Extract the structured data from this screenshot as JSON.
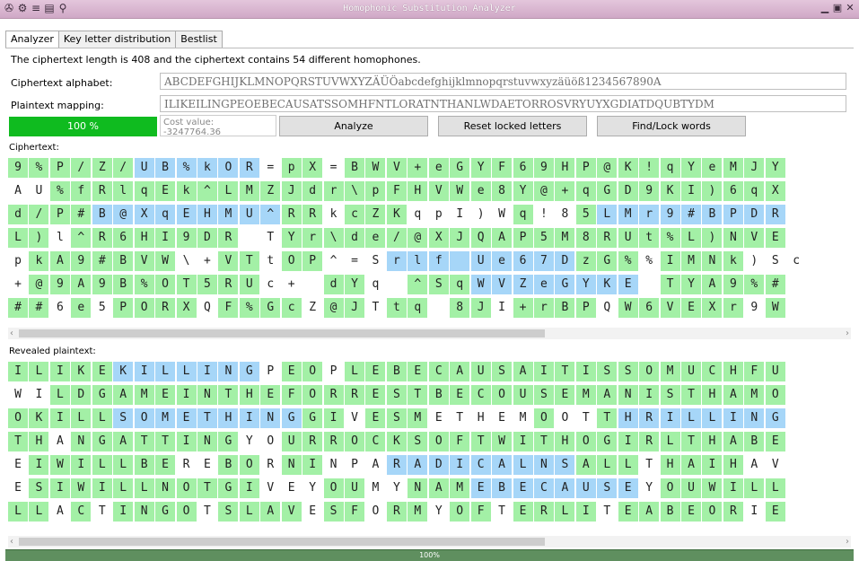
{
  "window": {
    "title": "Homophonic Substitution Analyzer"
  },
  "titlebar_icons": [
    "cipher-app-icon",
    "settings-gear-icon",
    "menu-icon",
    "document-icon",
    "magnifier-icon"
  ],
  "tabs": [
    {
      "label": "Analyzer",
      "active": true
    },
    {
      "label": "Key letter distribution",
      "active": false
    },
    {
      "label": "Bestlist",
      "active": false
    }
  ],
  "info_text": "The ciphertext length is 408 and the ciphertext contains 54 different homophones.",
  "ciphertext_alphabet": {
    "label": "Ciphertext alphabet:",
    "value": "ABCDEFGHIJKLMNOPQRSTUVWXYZÄÜÖabcdefghijklmnopqrstuvwxyzäüöß1234567890A"
  },
  "plaintext_mapping": {
    "label": "Plaintext mapping:",
    "value": "ILIKEILINGPEOEBECAUSATSSOMHFNTLORATNTHANLWDAETORROSVRYUYXGDIATDQUBTYDM"
  },
  "progress": {
    "label": "100 %",
    "value": 1.0
  },
  "cost": {
    "label": "Cost value: -3247764.36"
  },
  "buttons": {
    "analyze": "Analyze",
    "reset": "Reset locked letters",
    "find": "Find/Lock words"
  },
  "sections": {
    "ciphertext": "Ciphertext:",
    "plaintext": "Revealed plaintext:"
  },
  "colors": {
    "green": "#a3f0a6",
    "blue": "#a6d6f8",
    "progress": "#0fbb1f"
  },
  "ciphertext_rows": [
    {
      "chars": "9%P/Z/UB%kOR=pX=BWV+eGYF69HP@K!qYeMJY",
      "colors": "ggggggbbbbbb gg gggggggggggggggggggggg"
    },
    {
      "chars": "AU%fRlqEk^LMZJdr\\pFHVWe8Y@+qGD9KI)6qX",
      "colors": "  ggggggggggggggggggggggggggggggggggg"
    },
    {
      "chars": "d/P#B@XqEHMU^RRkcZKqpI)Wq!85LMr9#BPDR",
      "colors": "ggggbbbbbbbbbgg ggg     g  gbbbbbbbbbg"
    },
    {
      "chars": "L)l^R6HI9DR TYr\\de/@XJQAP5M8RUt%L)NVE",
      "colors": "gg gggggggg  gggggggggggggggggggggggg"
    },
    {
      "chars": "pkA9#BVW\\+VTtOP^=Srlf Ue67DzG%%IMNk)Sc",
      "colors": " ggggggg  gg gg   bbbbbbbbbggg gggg  "
    },
    {
      "chars": "+@9A9B%OT5RUc+ dYq ^SqWVZeGYKE TYA9%#",
      "colors": " ggggggggggg   gg  gggbbbbbbbb gggggg"
    },
    {
      "chars": "##6e5PORXQF%GcZ@JTtq 8JI+rBPQW6VEXr9W",
      "colors": "gg g gggg gggg gg gg gg gggg gggggg g"
    }
  ],
  "plaintext_rows": [
    {
      "chars": "ILIKEKILLINGPEOPLEBECAUSAITISSOMUCHFU",
      "colors": "gggggbbbbbbb gg gggggggggggggggggggggg"
    },
    {
      "chars": "WILDGAMEINTHEFORRESTBECOUSEMANISTHAMO",
      "colors": "  ggggggggggggggggggggggggggggggggggg"
    },
    {
      "chars": "OKILLSOMETHINGGIVESMETHEMOOTTHRILLING",
      "colors": "gggggbbbbbbbbbgg ggg     g  gbbbbbbbbbg"
    },
    {
      "chars": "THANGATTINGYOURROCKSOFTWITHOGIRLTHABE",
      "colors": "gg gggggggg  gggggggggggggggggggggggg"
    },
    {
      "chars": "EIWILLBEREBORNINPARADICALNSALLTHAIHAV",
      "colors": " ggggggg  gg gg   bbbbbbbbbggg gggg  "
    },
    {
      "chars": "ESIWILLNOTGIVEYOUMYNAMEBECAUSEYOUWILL",
      "colors": " ggggggggggg   gg  gggbbbbbbbb gggggg"
    },
    {
      "chars": "LLACTINGOTSLAVESFORMYOFTERLITEABEORIE",
      "colors": "gg g gggg gggg gg gg gg gggg gggggg g"
    }
  ],
  "status_text": "100%"
}
